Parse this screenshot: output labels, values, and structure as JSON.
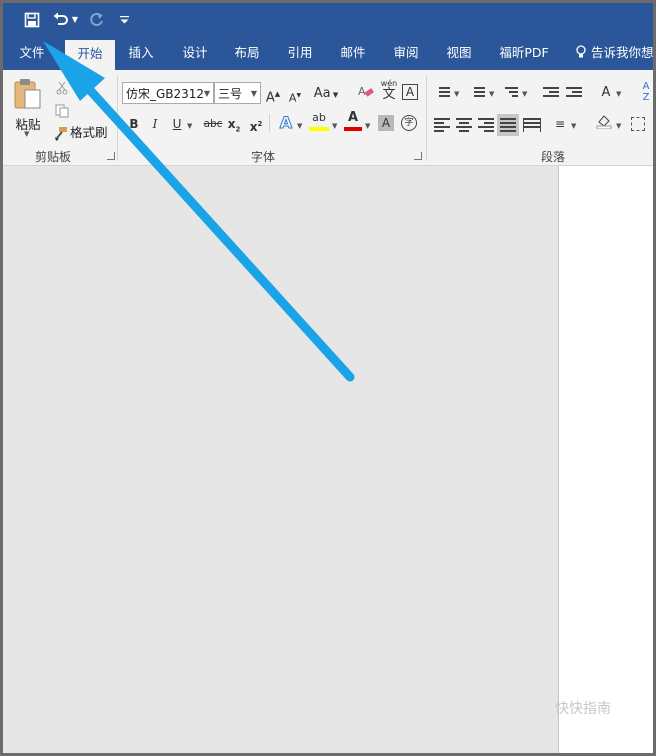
{
  "quick_access": {
    "save_icon": "save-icon",
    "undo_icon": "undo-icon",
    "redo_icon": "redo-icon",
    "customize_icon": "customize-qat-icon"
  },
  "tabs": [
    "文件",
    "开始",
    "插入",
    "设计",
    "布局",
    "引用",
    "邮件",
    "审阅",
    "视图",
    "福昕PDF"
  ],
  "active_tab": "开始",
  "tell_me": "告诉我你想",
  "clipboard": {
    "paste_label": "粘贴",
    "format_painter_label": "格式刷",
    "group_label": "剪贴板"
  },
  "font": {
    "font_name": "仿宋_GB2312",
    "font_size": "三号",
    "change_case_label": "Aa",
    "group_label": "字体",
    "phonetic_top": "wén",
    "phonetic_char": "文",
    "enclose_char": "字",
    "bold": "B",
    "italic": "I",
    "underline": "U",
    "strike": "abc",
    "sub_base": "x",
    "sub_mark": "2",
    "sup_base": "x",
    "sup_mark": "2",
    "highlight_label": "ab",
    "color_label": "A"
  },
  "paragraph": {
    "group_label": "段落"
  },
  "colors": {
    "title_bar": "#2b579a",
    "ribbon": "#f3f3f3",
    "arrow": "#1aa3e6",
    "highlight_yellow": "#ffff00",
    "font_color_red": "#e00000"
  },
  "watermark": "快快指南"
}
